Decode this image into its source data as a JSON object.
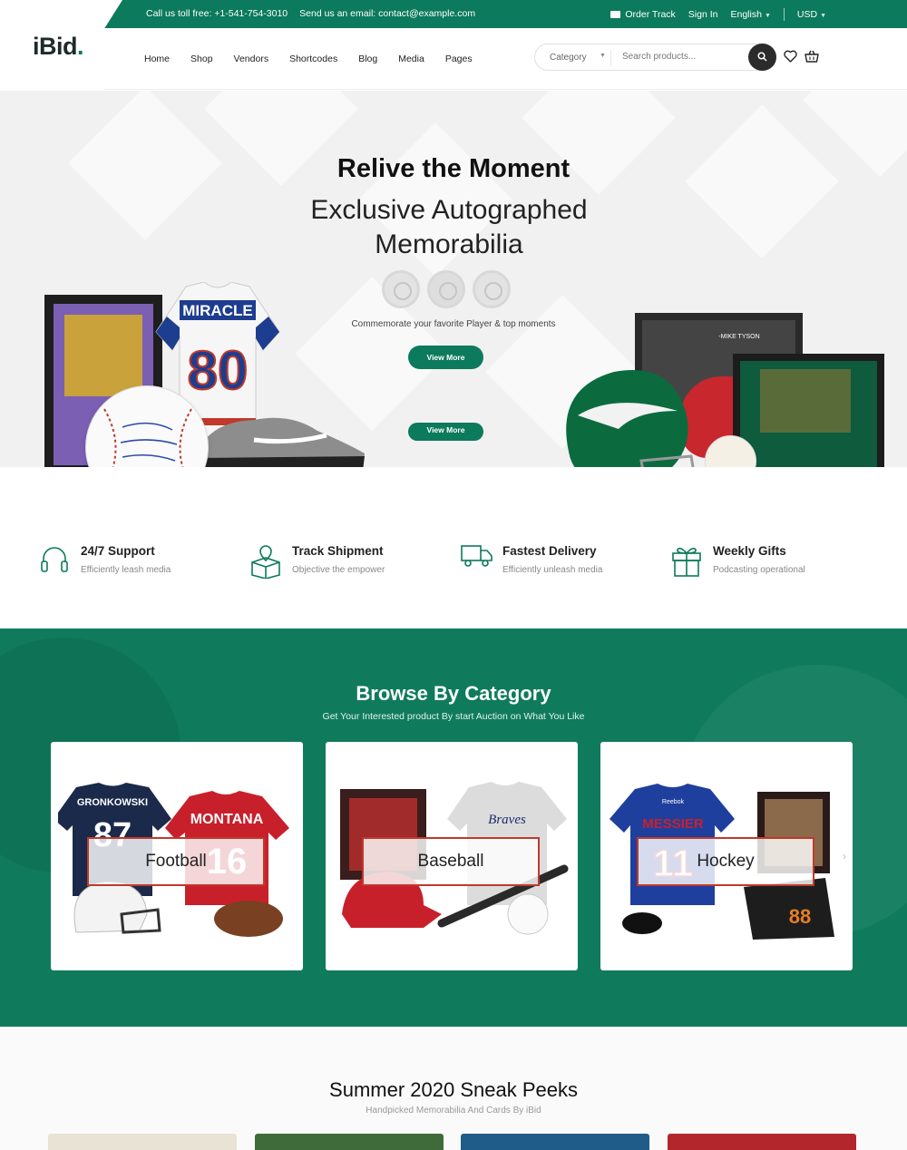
{
  "topbar": {
    "phone": "Call us toll free: +1-541-754-3010",
    "email": "Send us an email: contact@example.com",
    "order_track": "Order Track",
    "sign_in": "Sign In",
    "language": "English",
    "currency": "USD"
  },
  "brand": {
    "name": "iBid",
    "dot": ".",
    "accent": "#0c7a5c"
  },
  "nav": [
    "Home",
    "Shop",
    "Vendors",
    "Shortcodes",
    "Blog",
    "Media",
    "Pages"
  ],
  "search": {
    "category": "Category",
    "placeholder": "Search products..."
  },
  "hero": {
    "title": "Relive the Moment",
    "subtitle": "Exclusive Autographed Memorabilia",
    "caption": "Commemorate your favorite Player & top moments",
    "button": "View More",
    "button_secondary": "View More",
    "jersey_name": "MIRACLE",
    "jersey_number": "80",
    "frame_caption": "-MIKE TYSON"
  },
  "features": [
    {
      "title": "24/7 Support",
      "subtitle": "Efficiently leash media",
      "icon": "headphones-icon"
    },
    {
      "title": "Track Shipment",
      "subtitle": "Objective the empower",
      "icon": "package-location-icon"
    },
    {
      "title": "Fastest Delivery",
      "subtitle": "Efficiently unleash media",
      "icon": "truck-icon"
    },
    {
      "title": "Weekly Gifts",
      "subtitle": "Podcasting operational",
      "icon": "gift-icon"
    }
  ],
  "categories": {
    "title": "Browse By Category",
    "subtitle": "Get Your Interested product By start Auction on What You Like",
    "items": [
      {
        "label": "Football",
        "jersey_left": "GRONKOWSKI",
        "jersey_left_num": "87",
        "jersey_right": "MONTANA",
        "jersey_right_num": "16"
      },
      {
        "label": "Baseball",
        "jersey": "Braves"
      },
      {
        "label": "Hockey",
        "jersey": "MESSIER",
        "jersey_num": "11",
        "brand": "Reebok",
        "glove_num": "88"
      }
    ]
  },
  "peeks": {
    "title": "Summer 2020 Sneak Peeks",
    "subtitle": "Handpicked Memorabilia And Cards By iBid"
  },
  "colors": {
    "primary": "#0c7a5c",
    "category_bg": "#0f7b5c",
    "label_border": "#c0392b"
  }
}
